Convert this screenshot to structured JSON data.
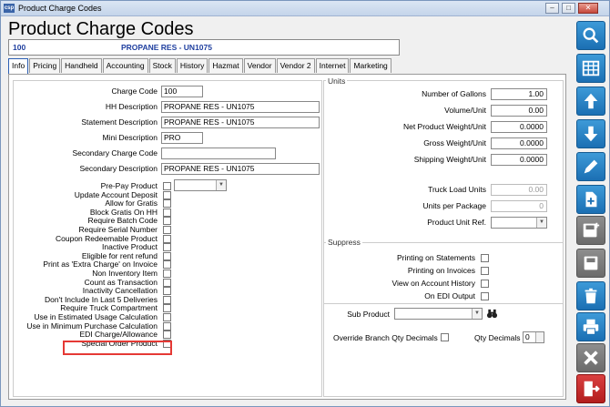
{
  "window": {
    "title": "Product Charge Codes",
    "app_icon": "csp"
  },
  "page_title": "Product Charge Codes",
  "header": {
    "code": "100",
    "description": "PROPANE RES - UN1075"
  },
  "tabs": [
    "Info",
    "Pricing",
    "Handheld",
    "Accounting",
    "Stock",
    "History",
    "Hazmat",
    "Vendor",
    "Vendor 2",
    "Internet",
    "Marketing"
  ],
  "fields": {
    "charge_code": {
      "label": "Charge Code",
      "value": "100"
    },
    "hh_description": {
      "label": "HH Description",
      "value": "PROPANE RES - UN1075"
    },
    "statement_description": {
      "label": "Statement Description",
      "value": "PROPANE RES - UN1075"
    },
    "mini_description": {
      "label": "Mini Description",
      "value": "PRO"
    },
    "secondary_charge_code": {
      "label": "Secondary Charge Code",
      "value": ""
    },
    "secondary_description": {
      "label": "Secondary Description",
      "value": "PROPANE RES - UN1075"
    }
  },
  "checkboxes": [
    "Pre-Pay Product",
    "Update Account Deposit",
    "Allow for Gratis",
    "Block Gratis On HH",
    "Require Batch Code",
    "Require Serial Number",
    "Coupon Redeemable Product",
    "Inactive Product",
    "Eligible for rent refund",
    "Print as 'Extra Charge' on Invoice",
    "Non Inventory Item",
    "Count as Transaction",
    "Inactivity Cancellation",
    "Don't Include In Last 5 Deliveries",
    "Require Truck Compartment",
    "Use in Estimated Usage Calculation",
    "Use in Minimum Purchase Calculation",
    "EDI Charge/Allowance",
    "Special Order Product"
  ],
  "units": {
    "section": "Units",
    "fields": [
      {
        "label": "Number of Gallons",
        "value": "1.00"
      },
      {
        "label": "Volume/Unit",
        "value": "0.00"
      },
      {
        "label": "Net Product Weight/Unit",
        "value": "0.0000"
      },
      {
        "label": "Gross Weight/Unit",
        "value": "0.0000"
      },
      {
        "label": "Shipping Weight/Unit",
        "value": "0.0000"
      },
      {
        "label": "Truck Load Units",
        "value": "0.00"
      },
      {
        "label": "Units per Package",
        "value": "0"
      },
      {
        "label": "Product Unit Ref.",
        "value": ""
      }
    ]
  },
  "suppress": {
    "section": "Suppress",
    "items": [
      "Printing on Statements",
      "Printing on Invoices",
      "View on Account History",
      "On EDI Output"
    ]
  },
  "sub_product": {
    "label": "Sub Product",
    "value": ""
  },
  "override_branch_qty": {
    "label": "Override Branch Qty Decimals"
  },
  "qty_decimals": {
    "label": "Qty Decimals",
    "value": "0"
  },
  "sidebar_buttons": [
    "search-icon",
    "grid-icon",
    "arrow-up-icon",
    "arrow-down-icon",
    "pencil-icon",
    "new-document-icon",
    "save-new-icon",
    "save-icon",
    "delete-icon",
    "print-icon",
    "cancel-icon",
    "exit-icon"
  ],
  "colors": {
    "accent_blue": "#1b6fb3",
    "header_text": "#1f3f9f",
    "highlight_red": "#e53935"
  }
}
